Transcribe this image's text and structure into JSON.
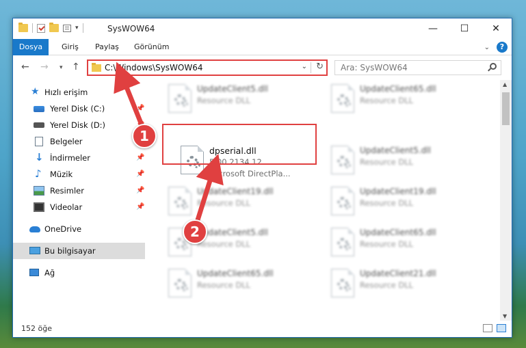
{
  "window": {
    "title": "SysWOW64",
    "controls": {
      "minimize": "—",
      "maximize": "☐",
      "close": "✕"
    }
  },
  "ribbon": {
    "tabs": [
      "Dosya",
      "Giriş",
      "Paylaş",
      "Görünüm"
    ],
    "help": "?"
  },
  "address": {
    "path": "C:\\Windows\\SysWOW64",
    "search_placeholder": "Ara: SysWOW64"
  },
  "sidebar": {
    "items": [
      {
        "label": "Hızlı erişim",
        "icon": "star-icon"
      },
      {
        "label": "Yerel Disk (C:)",
        "icon": "drive-icon"
      },
      {
        "label": "Yerel Disk (D:)",
        "icon": "drive-icon"
      },
      {
        "label": "Belgeler",
        "icon": "document-icon"
      },
      {
        "label": "İndirmeler",
        "icon": "download-icon"
      },
      {
        "label": "Müzik",
        "icon": "music-icon"
      },
      {
        "label": "Resimler",
        "icon": "pictures-icon"
      },
      {
        "label": "Videolar",
        "icon": "video-icon"
      },
      {
        "label": "OneDrive",
        "icon": "cloud-icon"
      },
      {
        "label": "Bu bilgisayar",
        "icon": "computer-icon"
      },
      {
        "label": "Ağ",
        "icon": "network-icon"
      }
    ]
  },
  "files": {
    "focus": {
      "name": "dpserial.dll",
      "version": "5.00.2134.12",
      "company": "Microsoft DirectPla..."
    },
    "blurred": [
      {
        "name": "UpdateClient5.dll",
        "desc": "Resource DLL"
      },
      {
        "name": "UpdateClient65.dll",
        "desc": "Resource DLL"
      },
      {
        "name": "UpdateClient5.dll",
        "desc": "Resource DLL"
      },
      {
        "name": "UpdateClient19.dll",
        "desc": "Resource DLL"
      },
      {
        "name": "UpdateClient19.dll",
        "desc": "Resource DLL"
      },
      {
        "name": "UpdateClient5.dll",
        "desc": "Resource DLL"
      },
      {
        "name": "UpdateClient65.dll",
        "desc": "Resource DLL"
      },
      {
        "name": "UpdateClient65.dll",
        "desc": "Resource DLL"
      },
      {
        "name": "UpdateClient21.dll",
        "desc": "Resource DLL"
      }
    ]
  },
  "status": {
    "count": "152 öğe"
  },
  "annotations": {
    "step1": "1",
    "step2": "2",
    "accent": "#e04040"
  }
}
